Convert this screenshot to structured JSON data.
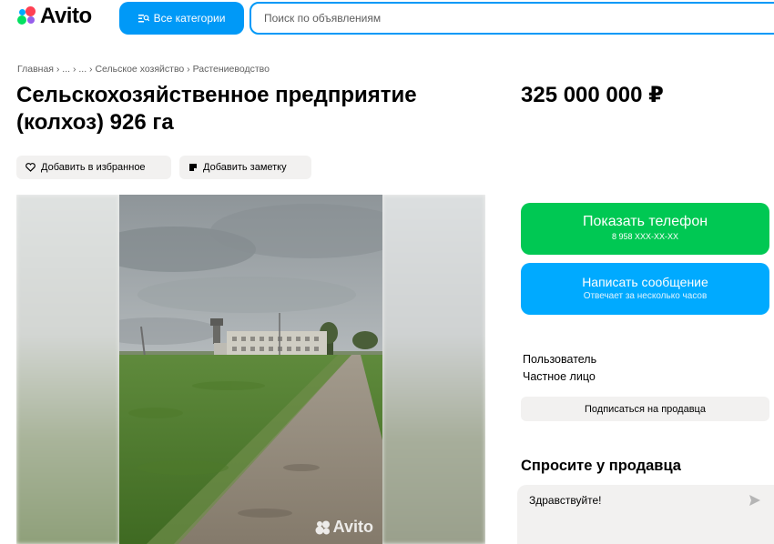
{
  "header": {
    "logo_text": "Avito",
    "categories_button": "Все категории",
    "search_placeholder": "Поиск по объявлениям"
  },
  "breadcrumb": "Главная › ... › ... › Сельское хозяйство › Растениеводство",
  "listing": {
    "title": "Сельскохозяйственное предприятие (колхоз) 926 га",
    "price": "325 000 000 ₽"
  },
  "actions": {
    "favorite": "Добавить в избранное",
    "note": "Добавить заметку"
  },
  "gallery": {
    "watermark": "Avito"
  },
  "contact": {
    "show_phone": "Показать телефон",
    "phone_masked": "8 958 XXX-XX-XX",
    "write_message": "Написать сообщение",
    "response_time": "Отвечает за несколько часов"
  },
  "seller": {
    "name": "Пользователь",
    "type": "Частное лицо",
    "subscribe": "Подписаться на продавца"
  },
  "ask": {
    "title": "Спросите у продавца",
    "message_value": "Здравствуйте!"
  },
  "colors": {
    "accent_blue": "#0099f7",
    "phone_green": "#00c853",
    "message_blue": "#00aaff",
    "chip_bg": "#f2f1f0"
  }
}
